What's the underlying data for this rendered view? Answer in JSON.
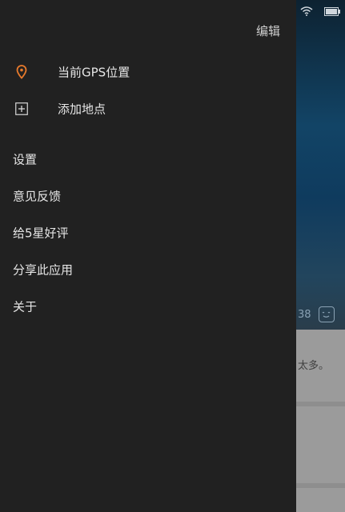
{
  "drawer": {
    "edit_label": "编辑",
    "locations": [
      {
        "label": "当前GPS位置",
        "icon": "location-pin-icon",
        "icon_color": "#e87a2c"
      },
      {
        "label": "添加地点",
        "icon": "add-square-icon"
      }
    ],
    "menu": [
      {
        "label": "设置"
      },
      {
        "label": "意见反馈"
      },
      {
        "label": "给5星好评"
      },
      {
        "label": "分享此应用"
      },
      {
        "label": "关于"
      }
    ]
  },
  "background": {
    "temperature": "38",
    "hint_text": "太多。"
  },
  "status_bar": {
    "icons": [
      "wifi-icon",
      "battery-icon"
    ]
  },
  "colors": {
    "drawer_bg": "#212121",
    "accent": "#e87a2c",
    "text": "#e6e6e6"
  }
}
